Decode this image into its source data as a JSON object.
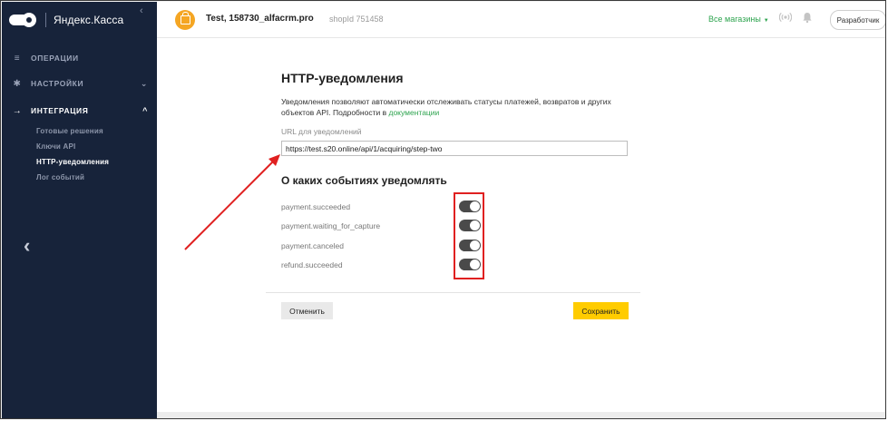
{
  "sidebar": {
    "logo_text": "Яндекс.Касса",
    "collapse_glyph": "‹",
    "menu": [
      {
        "label": "ОПЕРАЦИИ",
        "icon": "list-icon",
        "glyph": "≡",
        "chevron": ""
      },
      {
        "label": "НАСТРОЙКИ",
        "icon": "gear-icon",
        "glyph": "✱",
        "chevron": "⌄"
      },
      {
        "label": "ИНТЕГРАЦИЯ",
        "icon": "arrow-right-icon",
        "glyph": "→",
        "chevron": "^"
      }
    ],
    "submenu": [
      "Готовые решения",
      "Ключи API",
      "HTTP-уведомления",
      "Лог событий"
    ],
    "back_glyph": "‹"
  },
  "topbar": {
    "shop_name": "Test, 158730_alfacrm.pro",
    "shop_id": "shopId 751458",
    "all_shops": "Все магазины",
    "all_shops_caret": "▼",
    "developer_button": "Разработчик"
  },
  "page": {
    "title": "HTTP-уведомления",
    "description": "Уведомления позволяют автоматически отслеживать статусы платежей, возвратов и других объектов API. Подробности в ",
    "description_link": "документации",
    "url_label": "URL для уведомлений",
    "url_value": "https://test.s20.online/api/1/acquiring/step-two",
    "events_title": "О каких событиях уведомлять",
    "events": [
      {
        "label": "payment.succeeded",
        "enabled": true
      },
      {
        "label": "payment.waiting_for_capture",
        "enabled": true
      },
      {
        "label": "payment.canceled",
        "enabled": true
      },
      {
        "label": "refund.succeeded",
        "enabled": true
      }
    ],
    "cancel_label": "Отменить",
    "save_label": "Сохранить"
  },
  "colors": {
    "sidebar_bg": "#17233a",
    "accent_green": "#2ea44f",
    "save_yellow": "#ffcc00",
    "annotation_red": "#e02020",
    "shop_avatar": "#f5a623"
  }
}
